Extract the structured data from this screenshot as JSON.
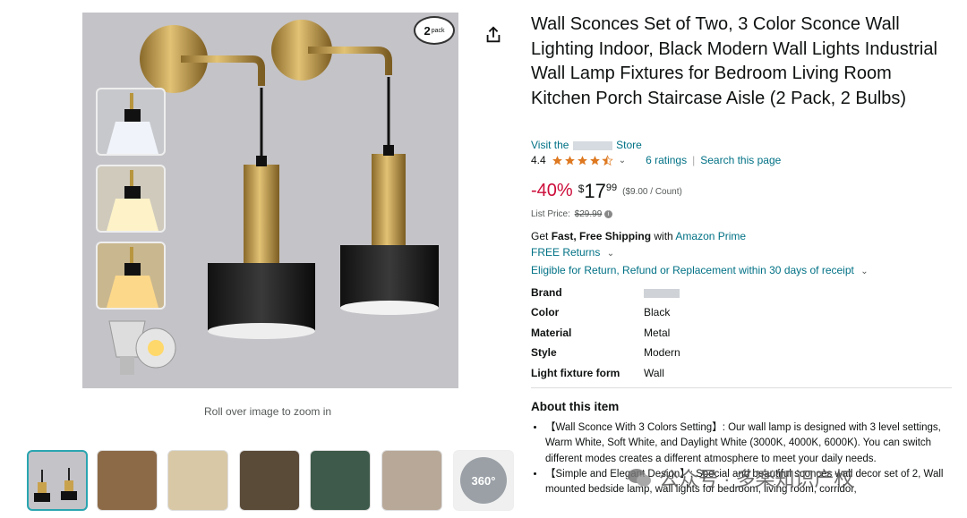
{
  "product": {
    "title": "Wall Sconces Set of Two, 3 Color Sconce Wall Lighting Indoor, Black Modern Wall Lights Industrial Wall Lamp Fixtures for Bedroom Living Room Kitchen Porch Staircase Aisle (2 Pack, 2 Bulbs)",
    "store_prefix": "Visit the",
    "store_suffix": "Store",
    "rating": "4.4",
    "stars_fraction": 0.88,
    "ratings_count": "6 ratings",
    "search_page": "Search this page",
    "discount": "-40%",
    "price_symbol": "$",
    "price_whole": "17",
    "price_fraction": "99",
    "unit_price": "($9.00 / Count)",
    "list_price_label": "List Price:",
    "list_price": "$29.99",
    "ship_prefix": "Get",
    "ship_bold": "Fast, Free Shipping",
    "ship_with": "with",
    "ship_link": "Amazon Prime",
    "free_returns": "FREE Returns",
    "eligible": "Eligible for Return, Refund or Replacement within 30 days of receipt"
  },
  "specs": [
    {
      "key": "Brand",
      "value": ""
    },
    {
      "key": "Color",
      "value": "Black"
    },
    {
      "key": "Material",
      "value": "Metal"
    },
    {
      "key": "Style",
      "value": "Modern"
    },
    {
      "key": "Light fixture form",
      "value": "Wall"
    }
  ],
  "about": {
    "heading": "About this item",
    "bullets": [
      "【Wall Sconce With 3 Colors Setting】: Our wall lamp is designed with 3 level settings, Warm White, Soft White, and Daylight White (3000K, 4000K, 6000K). You can switch different modes creates a different atmosphere to meet your daily needs.",
      "【Simple and Elegant Design】: Special and beautiful sconces wall decor set of 2, Wall mounted bedside lamp, wall lights for bedroom, living room, corridor,"
    ]
  },
  "gallery": {
    "badge_num": "2",
    "badge_word": "pack",
    "zoom_hint": "Roll over image to zoom in",
    "view_360": "360°"
  },
  "watermark": "公众号 · 多楽知识产权",
  "colors": {
    "link": "#007185",
    "discount": "#cc0c39",
    "star": "#de7921",
    "thumb_active": "#2aa5b0"
  }
}
